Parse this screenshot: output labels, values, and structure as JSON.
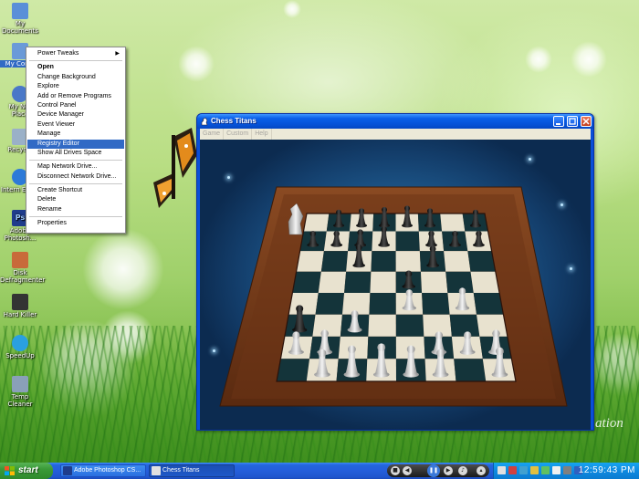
{
  "desktop": {
    "icons": [
      {
        "label": "My Documents",
        "color": "#5a8fd8"
      },
      {
        "label": "My Comp",
        "color": "#6a9ad8",
        "selected": true
      },
      {
        "label": "My Net Place",
        "color": "#4a78c8"
      },
      {
        "label": "Recycle",
        "color": "#9ab0c8"
      },
      {
        "label": "Intern Explo",
        "color": "#2d7ad8"
      },
      {
        "label": "Adobe Photosh...",
        "color": "#1f3c8c"
      },
      {
        "label": "Disk Defragmenter",
        "color": "#c86a3a"
      },
      {
        "label": "Hard Killer",
        "color": "#333333"
      },
      {
        "label": "SpeedUp",
        "color": "#2aa0e0"
      },
      {
        "label": "Temp Cleaner",
        "color": "#8aa0b8"
      }
    ],
    "watermark": "ation"
  },
  "context_menu": {
    "items": [
      {
        "label": "Power Tweaks",
        "submenu": true
      },
      {
        "separator": true
      },
      {
        "label": "Open",
        "bold": true
      },
      {
        "label": "Change Background"
      },
      {
        "label": "Explore"
      },
      {
        "label": "Add or Remove Programs"
      },
      {
        "label": "Control Panel"
      },
      {
        "label": "Device Manager"
      },
      {
        "label": "Event Viewer"
      },
      {
        "label": "Manage"
      },
      {
        "label": "Registry Editor",
        "highlighted": true
      },
      {
        "label": "Show All Drives Space"
      },
      {
        "separator": true
      },
      {
        "label": "Map Network Drive..."
      },
      {
        "label": "Disconnect Network Drive..."
      },
      {
        "separator": true
      },
      {
        "label": "Create Shortcut"
      },
      {
        "label": "Delete"
      },
      {
        "label": "Rename"
      },
      {
        "separator": true
      },
      {
        "label": "Properties"
      }
    ]
  },
  "chess_window": {
    "title": "Chess Titans",
    "menu": [
      "Game",
      "Custom",
      "Help"
    ]
  },
  "taskbar": {
    "start_label": "start",
    "tasks": [
      {
        "label": "Adobe Photoshop CS...",
        "active": false
      },
      {
        "label": "Chess Titans",
        "active": true
      }
    ],
    "clock": "12:59:43 PM"
  }
}
